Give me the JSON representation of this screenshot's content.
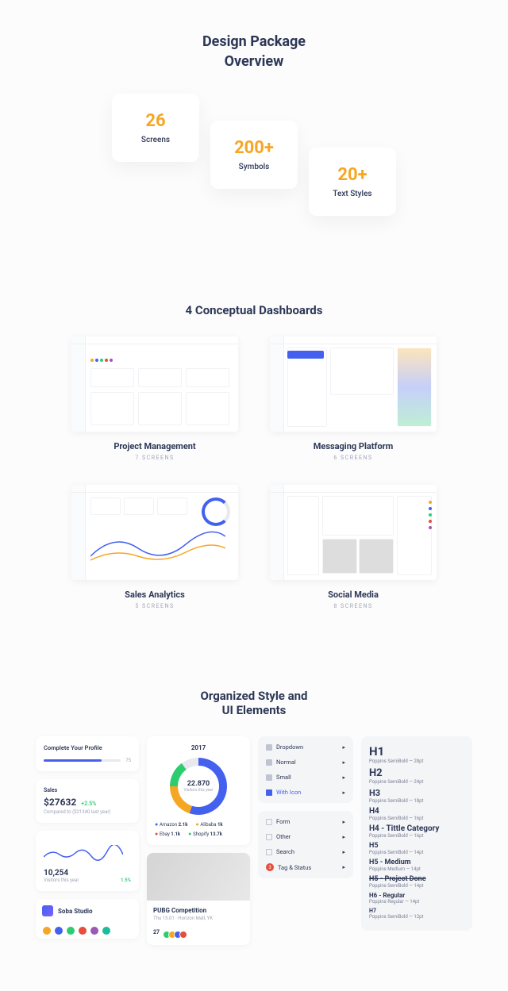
{
  "hero": {
    "title1": "Design Package",
    "title2": "Overview"
  },
  "stats": [
    {
      "num": "26",
      "label": "Screens"
    },
    {
      "num": "200+",
      "label": "Symbols"
    },
    {
      "num": "20+",
      "label": "Text Styles"
    }
  ],
  "dash_heading": "4 Conceptual Dashboards",
  "dashboards": [
    {
      "title": "Project Management",
      "sub": "7 Screens"
    },
    {
      "title": "Messaging Platform",
      "sub": "6 Screens"
    },
    {
      "title": "Sales Analytics",
      "sub": "5 Screens"
    },
    {
      "title": "Social Media",
      "sub": "8 Screens"
    }
  ],
  "ui_heading1": "Organized Style and",
  "ui_heading2": "UI Elements",
  "profile": {
    "label": "Complete Your Profile",
    "pct": "75"
  },
  "sales": {
    "label": "Sales",
    "value": "$27632",
    "pct": "+2.5%",
    "sub": "Compared to ($21340 last year)"
  },
  "visitors": {
    "num": "10,254",
    "sub": "Visitors this year",
    "pct": "1.5%"
  },
  "soba": "Soba Studio",
  "donut": {
    "year": "2017",
    "num": "22.870",
    "sub": "Visitors this year"
  },
  "legend": [
    {
      "k": "Amazon",
      "v": "2.1k"
    },
    {
      "k": "Alibaba",
      "v": "1k"
    },
    {
      "k": "Ebay",
      "v": "1.1k"
    },
    {
      "k": "Shopify",
      "v": "13.7k"
    }
  ],
  "event": {
    "title": "PUBG Competition",
    "sub": "Thu 15.01 · Horizon Mall, YK",
    "count": "27"
  },
  "menu1": [
    {
      "label": "Dropdown",
      "cls": ""
    },
    {
      "label": "Normal",
      "cls": ""
    },
    {
      "label": "Small",
      "cls": ""
    },
    {
      "label": "With Icon",
      "cls": "menu-blue"
    }
  ],
  "menu2": [
    {
      "label": "Form"
    },
    {
      "label": "Other"
    },
    {
      "label": "Search"
    },
    {
      "label": "Tag & Status",
      "badge": "3"
    }
  ],
  "type": [
    {
      "h": "H1",
      "hs": "15",
      "s": "Poppins SemiBold — 28pt"
    },
    {
      "h": "H2",
      "hs": "13",
      "s": "Poppins SemiBold — 24pt"
    },
    {
      "h": "H3",
      "hs": "11",
      "s": "Poppins SemiBold — 18pt"
    },
    {
      "h": "H4",
      "hs": "10",
      "s": "Poppins SemiBold — 16pt"
    },
    {
      "h": "H4 - Tittle Category",
      "hs": "10",
      "s": "Poppins SemiBold — 16pt"
    },
    {
      "h": "H5",
      "hs": "9",
      "s": "Poppins SemiBold — 14pt"
    },
    {
      "h": "H5 - Medium",
      "hs": "9",
      "s": "Poppins Medium — 14pt"
    },
    {
      "h": "H5 - Project Done",
      "hs": "9",
      "s": "Poppins SemiBold — 14pt",
      "strike": true
    },
    {
      "h": "H6 - Regular",
      "hs": "8",
      "s": "Poppins Regular — 14pt"
    },
    {
      "h": "H7",
      "hs": "7",
      "s": "Poppins SemiBold — 12pt"
    }
  ]
}
